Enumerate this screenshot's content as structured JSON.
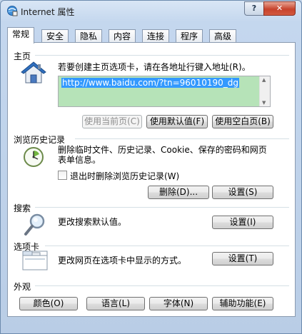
{
  "window": {
    "title": "Internet 属性",
    "help_label": "?",
    "close_label": "✕"
  },
  "tabs": [
    {
      "label": "常规"
    },
    {
      "label": "安全"
    },
    {
      "label": "隐私"
    },
    {
      "label": "内容"
    },
    {
      "label": "连接"
    },
    {
      "label": "程序"
    },
    {
      "label": "高级"
    }
  ],
  "homepage": {
    "title": "主页",
    "description": "若要创建主页选项卡，请在各地址行键入地址(R)。",
    "url": "http://www.baidu.com/?tn=96010190_dg",
    "use_current_label": "使用当前页(C)",
    "use_default_label": "使用默认值(F)",
    "use_blank_label": "使用空白页(B)"
  },
  "history": {
    "title": "浏览历史记录",
    "description_line1": "删除临时文件、历史记录、Cookie、保存的密码和网页",
    "description_line2": "表单信息。",
    "checkbox_label": "退出时删除浏览历史记录(W)",
    "checkbox_checked": false,
    "delete_label": "删除(D)...",
    "settings_label": "设置(S)"
  },
  "search": {
    "title": "搜索",
    "description": "更改搜索默认值。",
    "settings_label": "设置(I)"
  },
  "tabs_section": {
    "title": "选项卡",
    "description": "更改网页在选项卡中显示的方式。",
    "settings_label": "设置(T)"
  },
  "appearance": {
    "title": "外观",
    "colors_label": "颜色(O)",
    "languages_label": "语言(L)",
    "fonts_label": "字体(N)",
    "accessibility_label": "辅助功能(E)"
  }
}
